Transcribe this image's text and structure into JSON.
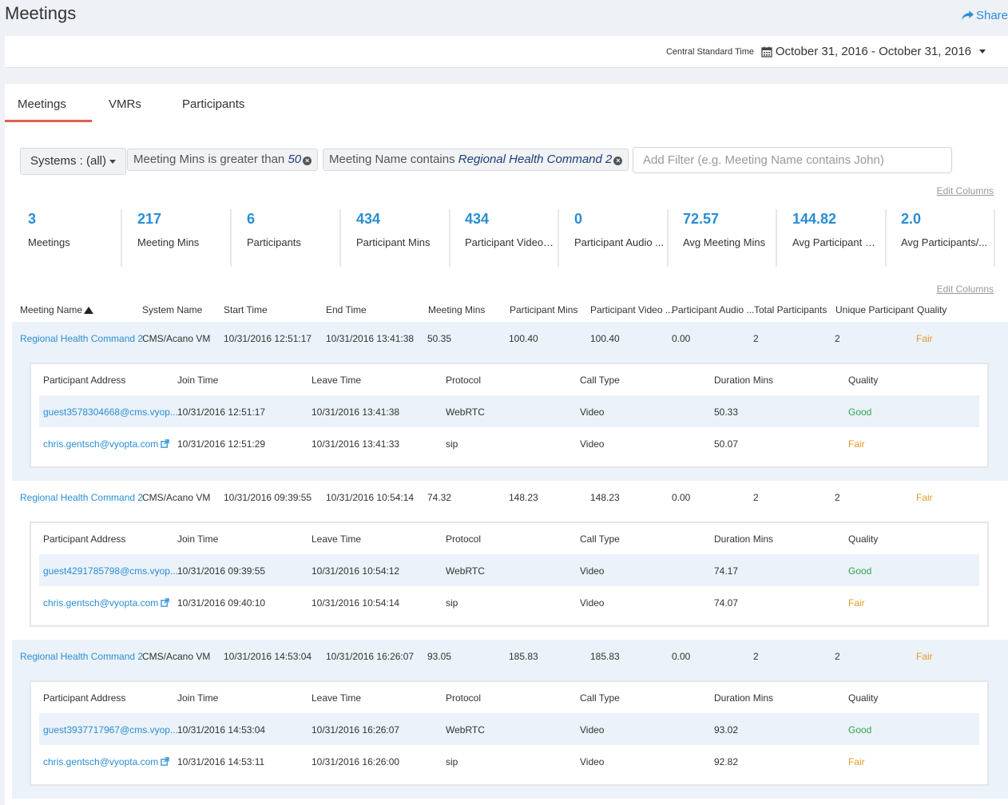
{
  "page": {
    "title": "Meetings",
    "share_label": "Share",
    "timezone": "Central Standard Time",
    "date_range": "October 31, 2016 - October 31, 2016"
  },
  "tabs": [
    {
      "label": "Meetings",
      "active": true
    },
    {
      "label": "VMRs"
    },
    {
      "label": "Participants"
    }
  ],
  "filters": {
    "systems_label": "Systems : (all)",
    "chips": [
      {
        "prefix": "Meeting Mins is greater than",
        "value": "50"
      },
      {
        "prefix": "Meeting Name contains",
        "value": "Regional Health Command 2"
      }
    ],
    "add_placeholder": "Add Filter (e.g. Meeting Name contains John)",
    "edit_columns": "Edit Columns"
  },
  "kpis": [
    {
      "value": "3",
      "label": "Meetings"
    },
    {
      "value": "217",
      "label": "Meeting Mins"
    },
    {
      "value": "6",
      "label": "Participants"
    },
    {
      "value": "434",
      "label": "Participant Mins"
    },
    {
      "value": "434",
      "label": "Participant Video ..."
    },
    {
      "value": "0",
      "label": "Participant Audio ..."
    },
    {
      "value": "72.57",
      "label": "Avg Meeting Mins"
    },
    {
      "value": "144.82",
      "label": "Avg Participant M..."
    },
    {
      "value": "2.0",
      "label": "Avg Participants/..."
    }
  ],
  "table": {
    "edit_columns": "Edit Columns",
    "columns": [
      "Meeting Name",
      "System Name",
      "Start Time",
      "End Time",
      "Meeting Mins",
      "Participant Mins",
      "Participant Video ...",
      "Participant Audio ...",
      "Total Participants",
      "Unique Participant",
      "Quality"
    ],
    "sub_columns": [
      "Participant Address",
      "Join Time",
      "Leave Time",
      "Protocol",
      "Call Type",
      "Duration Mins",
      "Quality"
    ],
    "meetings": [
      {
        "cells": [
          "Regional Health Command 2",
          "CMS/Acano VM",
          "10/31/2016 12:51:17",
          "10/31/2016 13:41:38",
          "50.35",
          "100.40",
          "100.40",
          "0.00",
          "2",
          "2",
          "Fair"
        ],
        "participants": [
          [
            "guest3578304668@cms.vyop...",
            "10/31/2016 12:51:17",
            "10/31/2016 13:41:38",
            "WebRTC",
            "Video",
            "50.33",
            "Good"
          ],
          [
            "chris.gentsch@vyopta.com",
            "10/31/2016 12:51:29",
            "10/31/2016 13:41:33",
            "sip",
            "Video",
            "50.07",
            "Fair"
          ]
        ]
      },
      {
        "cells": [
          "Regional Health Command 2",
          "CMS/Acano VM",
          "10/31/2016 09:39:55",
          "10/31/2016 10:54:14",
          "74.32",
          "148.23",
          "148.23",
          "0.00",
          "2",
          "2",
          "Fair"
        ],
        "participants": [
          [
            "guest4291785798@cms.vyop...",
            "10/31/2016 09:39:55",
            "10/31/2016 10:54:12",
            "WebRTC",
            "Video",
            "74.17",
            "Good"
          ],
          [
            "chris.gentsch@vyopta.com",
            "10/31/2016 09:40:10",
            "10/31/2016 10:54:14",
            "sip",
            "Video",
            "74.07",
            "Fair"
          ]
        ]
      },
      {
        "cells": [
          "Regional Health Command 2",
          "CMS/Acano VM",
          "10/31/2016 14:53:04",
          "10/31/2016 16:26:07",
          "93.05",
          "185.83",
          "185.83",
          "0.00",
          "2",
          "2",
          "Fair"
        ],
        "participants": [
          [
            "guest3937717967@cms.vyop...",
            "10/31/2016 14:53:04",
            "10/31/2016 16:26:07",
            "WebRTC",
            "Video",
            "93.02",
            "Good"
          ],
          [
            "chris.gentsch@vyopta.com",
            "10/31/2016 14:53:11",
            "10/31/2016 16:26:00",
            "sip",
            "Video",
            "92.82",
            "Fair"
          ]
        ]
      }
    ]
  },
  "colors": {
    "accent": "#2a8dd4",
    "tab_underline": "#e05e54",
    "fair": "#e49a27",
    "good": "#2ea44f",
    "row_shade": "#ecf2f9"
  }
}
